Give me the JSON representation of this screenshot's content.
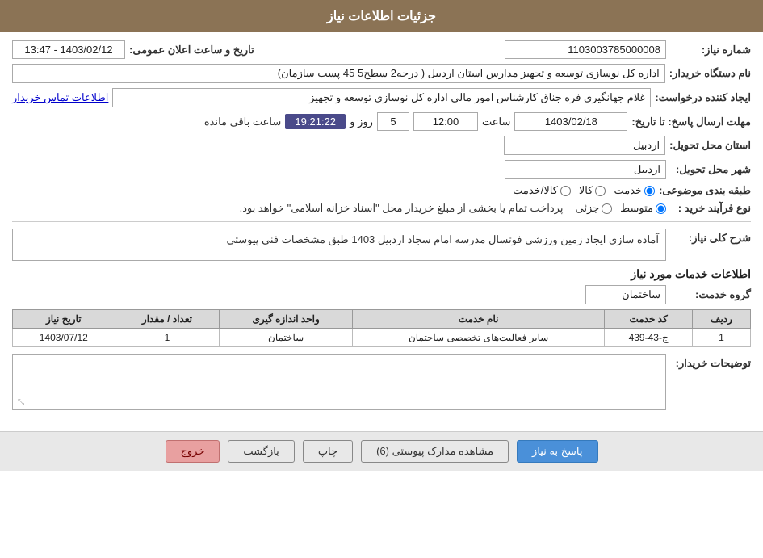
{
  "page": {
    "title": "جزئیات اطلاعات نیاز"
  },
  "header": {
    "title": "جزئیات اطلاعات نیاز"
  },
  "fields": {
    "need_number_label": "شماره نیاز:",
    "need_number_value": "1103003785000008",
    "announce_datetime_label": "تاریخ و ساعت اعلان عمومی:",
    "announce_datetime_value": "1403/02/12 - 13:47",
    "buyer_name_label": "نام دستگاه خریدار:",
    "buyer_name_value": "اداره کل نوسازی   توسعه و تجهیز مدارس استان اردبیل ( درجه2  سطح5  45  پست سازمان)",
    "creator_label": "ایجاد کننده درخواست:",
    "creator_value": "غلام جهانگیری فره جناق کارشناس امور مالی اداره کل نوسازی   توسعه و تجهیز",
    "contact_link": "اطلاعات تماس خریدار",
    "deadline_label": "مهلت ارسال پاسخ: تا تاریخ:",
    "deadline_date": "1403/02/18",
    "deadline_time_label": "ساعت",
    "deadline_time": "12:00",
    "deadline_days_label": "روز و",
    "deadline_days": "5",
    "deadline_remaining_label": "ساعت باقی مانده",
    "deadline_remaining_time": "19:21:22",
    "province_label": "استان محل تحویل:",
    "province_value": "اردبیل",
    "city_label": "شهر محل تحویل:",
    "city_value": "اردبیل",
    "category_label": "طبقه بندی موضوعی:",
    "radio_kala": "کالا",
    "radio_khadamat": "خدمت",
    "radio_kala_khadamat": "کالا/خدمت",
    "radio_selected": "khadamat",
    "purchase_type_label": "نوع فرآیند خرید :",
    "radio_jozvi": "جزئی",
    "radio_motevaset": "متوسط",
    "radio_purchase_selected": "motevaset",
    "payment_note": "پرداخت تمام یا بخشی از مبلغ خریدار محل \"اسناد خزانه اسلامی\" خواهد بود.",
    "need_desc_label": "شرح کلی نیاز:",
    "need_desc_value": "آماده سازی ایجاد زمین ورزشی فوتسال مدرسه امام سجاد اردبیل 1403 طبق مشخصات فنی پیوستی",
    "service_info_title": "اطلاعات خدمات مورد نیاز",
    "service_group_label": "گروه خدمت:",
    "service_group_value": "ساختمان",
    "table": {
      "headers": [
        "ردیف",
        "کد خدمت",
        "نام خدمت",
        "واحد اندازه گیری",
        "تعداد / مقدار",
        "تاریخ نیاز"
      ],
      "rows": [
        {
          "row_num": "1",
          "service_code": "ج-43-439",
          "service_name": "سایر فعالیت‌های تخصصی ساختمان",
          "unit": "ساختمان",
          "quantity": "1",
          "date": "1403/07/12"
        }
      ]
    },
    "buyer_desc_label": "توضیحات خریدار:",
    "buyer_desc_value": ""
  },
  "buttons": {
    "answer_label": "پاسخ به نیاز",
    "view_docs_label": "مشاهده مدارک پیوستی (6)",
    "print_label": "چاپ",
    "back_label": "بازگشت",
    "exit_label": "خروج"
  }
}
